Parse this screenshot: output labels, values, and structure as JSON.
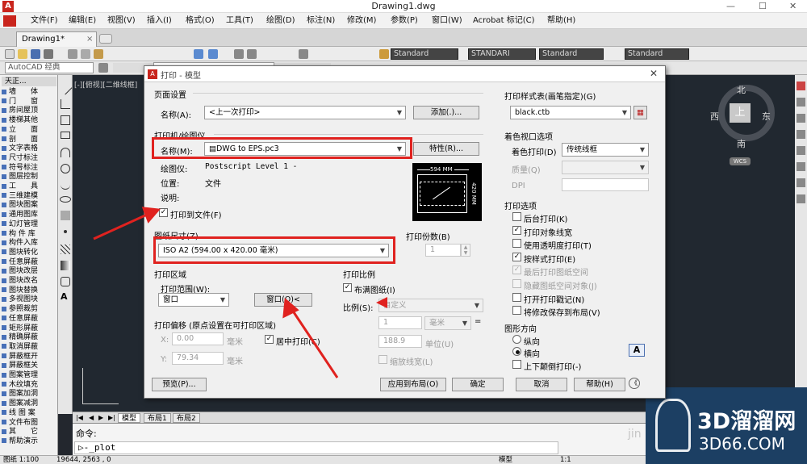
{
  "window": {
    "title": "Drawing1.dwg",
    "min": "—",
    "max": "☐",
    "close": "✕"
  },
  "menu": [
    "文件(F)",
    "编辑(E)",
    "视图(V)",
    "插入(I)",
    "格式(O)",
    "工具(T)",
    "绘图(D)",
    "标注(N)",
    "修改(M)",
    "参数(P)",
    "窗口(W)",
    "Acrobat 标记(C)",
    "帮助(H)"
  ],
  "doctab": {
    "name": "Drawing1*",
    "close": "×"
  },
  "toolbar": {
    "workspace": "AutoCAD 经典",
    "style1": "Standard",
    "style2": "STANDARI",
    "style3": "Standard",
    "style4": "Standard"
  },
  "left_panel": {
    "header": "天正...",
    "items": [
      "墙　　体",
      "门　　窗",
      "房间屋顶",
      "楼梯其他",
      "立　　面",
      "剖　　面",
      "文字表格",
      "尺寸标注",
      "符号标注",
      "图层控制",
      "工　　具",
      "三维建模",
      "图块图案",
      "通用图库",
      "幻灯管理",
      "构 件 库",
      "构件入库",
      "图块转化",
      "任意屏蔽",
      "图块改层",
      "图块改名",
      "图块替换",
      "多视图块",
      "参照裁剪",
      "任意屏蔽",
      "矩形屏蔽",
      "精确屏蔽",
      "取消屏蔽",
      "屏蔽框开",
      "屏蔽框关",
      "图案管理",
      "木纹填充",
      "图案加洞",
      "图案减洞",
      "线 图 案",
      "文件布图",
      "其　　它",
      "帮助演示"
    ]
  },
  "viewport_label": "[-][俯视][二维线框]",
  "viewcube": {
    "north": "北",
    "south": "南",
    "east": "东",
    "west": "西",
    "top": "上",
    "wcs": "WCS"
  },
  "layout_tabs": [
    "模型",
    "布局1",
    "布局2"
  ],
  "command": {
    "label": "命令:",
    "input": "_plot"
  },
  "status": {
    "scale": "图纸 1:100",
    "coords": "19644, 2563 , 0",
    "model": "模型",
    "ratio": "1:1"
  },
  "watermark": {
    "brand": "3D溜溜网",
    "url": "3D66.COM",
    "jin": "jin"
  },
  "dialog": {
    "title": "打印 - 模型",
    "page_setup": {
      "title": "页面设置",
      "name_label": "名称(A):",
      "name_value": "<上一次打印>",
      "add_button": "添加(.)..."
    },
    "printer": {
      "title": "打印机/绘图仪",
      "name_label": "名称(M):",
      "name_value": "DWG to EPS.pc3",
      "properties_button": "特性(R)...",
      "plotter_label": "绘图仪:",
      "plotter_value": "Postscript Level 1 -",
      "location_label": "位置:",
      "location_value": "文件",
      "desc_label": "说明:",
      "plot_to_file": "打印到文件(F)",
      "preview_width": "594 MM",
      "preview_height": "420 MM"
    },
    "paper_size": {
      "title": "图纸尺寸(Z)",
      "value": "ISO A2 (594.00 x 420.00 毫米)"
    },
    "copies": {
      "title": "打印份数(B)",
      "value": "1"
    },
    "plot_area": {
      "title": "打印区域",
      "range_label": "打印范围(W):",
      "range_value": "窗口",
      "window_button": "窗口(O)<"
    },
    "plot_offset": {
      "title": "打印偏移 (原点设置在可打印区域)",
      "x_label": "X:",
      "x_value": "0.00",
      "y_label": "Y:",
      "y_value": "79.34",
      "unit": "毫米",
      "center": "居中打印(C)"
    },
    "plot_scale": {
      "title": "打印比例",
      "fit": "布满图纸(I)",
      "scale_label": "比例(S):",
      "scale_value": "自定义",
      "num1": "1",
      "unit1": "毫米",
      "eq": "=",
      "num2": "188.9",
      "unit2": "单位(U)",
      "lineweight": "缩放线宽(L)"
    },
    "style_table": {
      "title": "打印样式表(画笔指定)(G)",
      "value": "black.ctb"
    },
    "shaded": {
      "title": "着色视口选项",
      "shade_label": "着色打印(D)",
      "shade_value": "传统线框",
      "quality_label": "质量(Q)",
      "dpi_label": "DPI"
    },
    "options": {
      "title": "打印选项",
      "items": [
        {
          "label": "后台打印(K)",
          "checked": false,
          "enabled": true
        },
        {
          "label": "打印对象线宽",
          "checked": true,
          "enabled": true
        },
        {
          "label": "使用透明度打印(T)",
          "checked": false,
          "enabled": true
        },
        {
          "label": "按样式打印(E)",
          "checked": true,
          "enabled": true
        },
        {
          "label": "最后打印图纸空间",
          "checked": true,
          "enabled": false
        },
        {
          "label": "隐藏图纸空间对象(J)",
          "checked": false,
          "enabled": false
        },
        {
          "label": "打开打印戳记(N)",
          "checked": false,
          "enabled": true
        },
        {
          "label": "将修改保存到布局(V)",
          "checked": false,
          "enabled": true
        }
      ]
    },
    "orientation": {
      "title": "图形方向",
      "portrait": "纵向",
      "landscape": "横向",
      "upside": "上下颠倒打印(-)",
      "icon": "A"
    },
    "buttons": {
      "preview": "预览(P)...",
      "apply": "应用到布局(O)",
      "ok": "确定",
      "cancel": "取消",
      "help": "帮助(H)",
      "more": "《"
    }
  },
  "colors": {
    "accent_red": "#e0221f",
    "canvas": "#212830",
    "dialog_bg": "#f0f0f0"
  }
}
